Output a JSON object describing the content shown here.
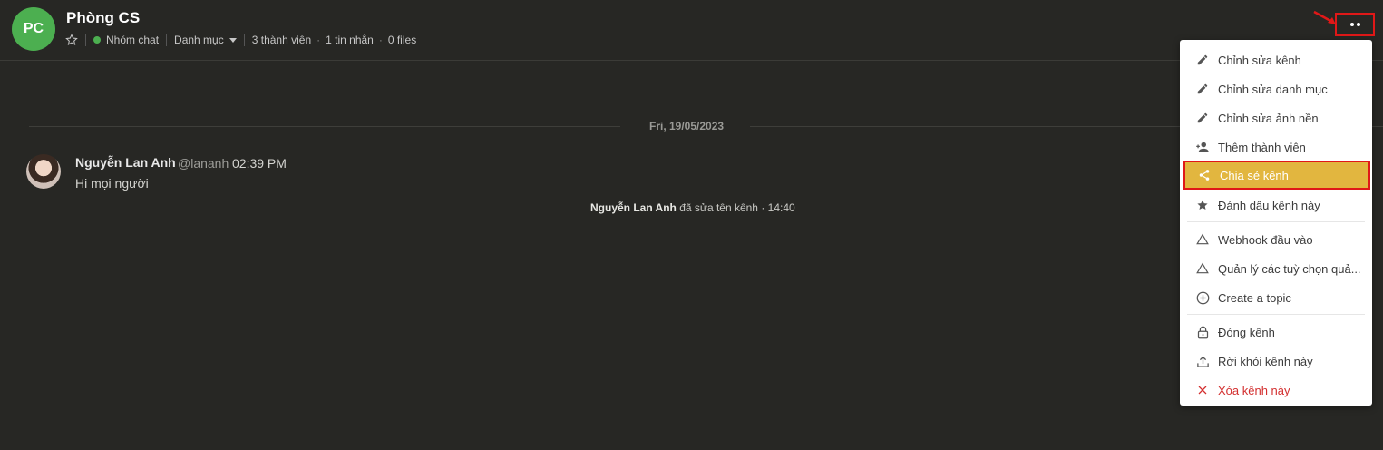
{
  "header": {
    "avatar_initials": "PC",
    "title": "Phòng CS",
    "type_label": "Nhóm chat",
    "category_label": "Danh mục",
    "members": "3 thành viên",
    "messages": "1 tin nhắn",
    "files": "0 files"
  },
  "chat": {
    "date_divider": "Fri, 19/05/2023",
    "message": {
      "author": "Nguyễn Lan Anh",
      "handle": "@lananh",
      "time": "02:39 PM",
      "text": "Hi mọi người"
    },
    "system": {
      "actor": "Nguyễn Lan Anh",
      "action": " đã sửa tên kênh · 14:40"
    }
  },
  "menu": {
    "items": [
      {
        "label": "Chỉnh sửa kênh",
        "icon": "pencil-icon"
      },
      {
        "label": "Chỉnh sửa danh mục",
        "icon": "pencil-icon"
      },
      {
        "label": "Chỉnh sửa ảnh nền",
        "icon": "pencil-icon"
      },
      {
        "label": "Thêm thành viên",
        "icon": "add-person-icon"
      },
      {
        "label": "Chia sẻ kênh",
        "icon": "share-icon"
      },
      {
        "label": "Đánh dấu kênh này",
        "icon": "star-icon"
      },
      {
        "label": "Webhook đầu vào",
        "icon": "triangle-icon"
      },
      {
        "label": "Quản lý các tuỳ chọn quả...",
        "icon": "triangle-icon"
      },
      {
        "label": "Create a topic",
        "icon": "plus-circle-icon"
      },
      {
        "label": "Đóng kênh",
        "icon": "lock-icon"
      },
      {
        "label": "Rời khỏi kênh này",
        "icon": "upload-icon"
      },
      {
        "label": "Xóa kênh này",
        "icon": "close-icon"
      }
    ]
  },
  "colors": {
    "background": "#272724",
    "accent_online": "#4caf50",
    "highlight": "#e2b63f",
    "annotation_red": "#e01818",
    "danger": "#d32f2f"
  }
}
